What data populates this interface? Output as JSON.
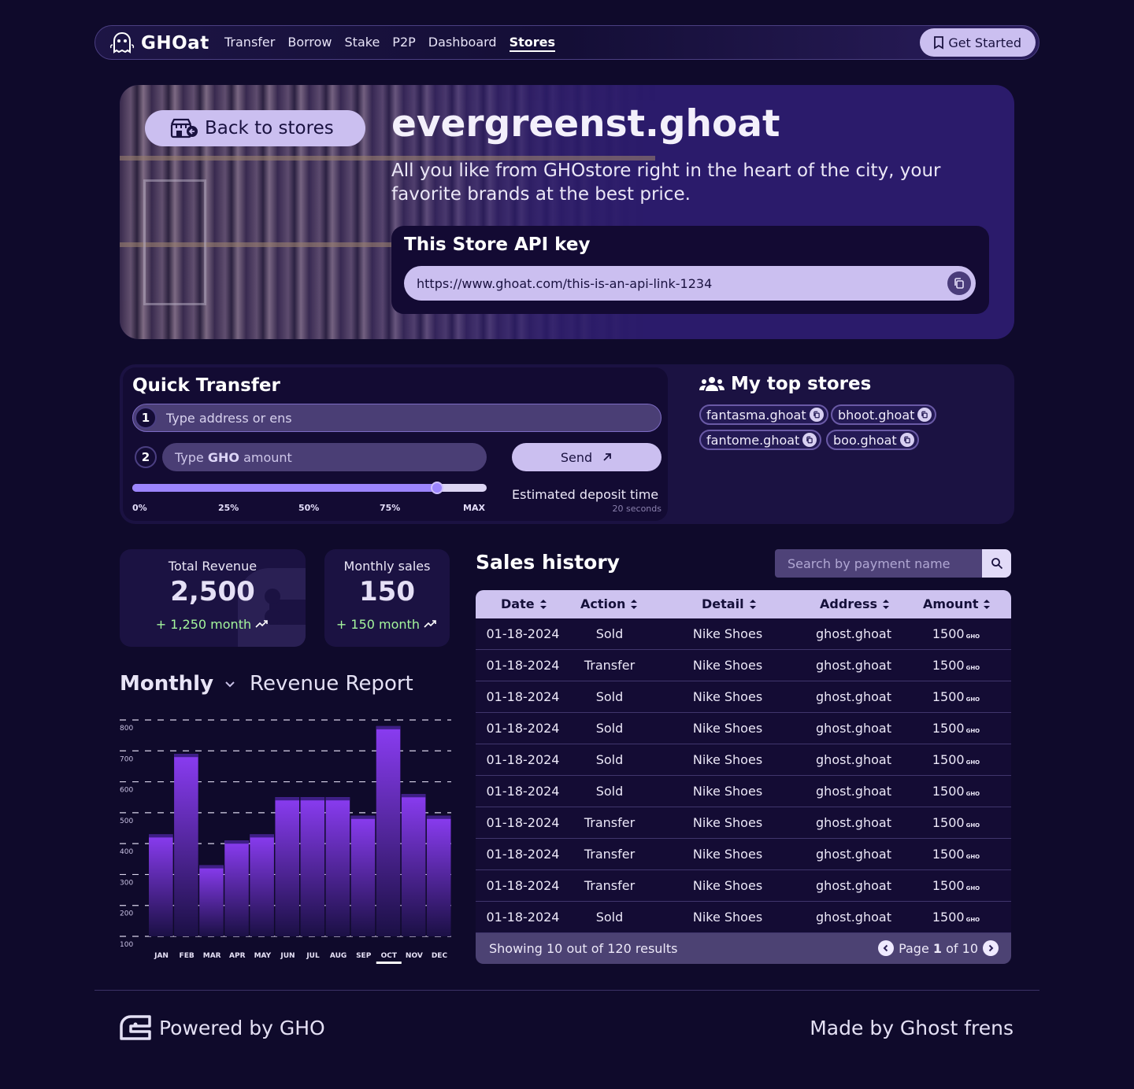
{
  "nav": {
    "brand": "GHOat",
    "links": [
      "Transfer",
      "Borrow",
      "Stake",
      "P2P",
      "Dashboard",
      "Stores"
    ],
    "active": "Stores",
    "cta": "Get Started"
  },
  "hero": {
    "back_label": "Back to stores",
    "store_name": "evergreenst.ghoat",
    "description": "All you like from GHOstore right in the heart of the city, your favorite brands at the best price.",
    "api_title": "This Store API key",
    "api_url": "https://www.ghoat.com/this-is-an-api-link-1234"
  },
  "quick_transfer": {
    "title": "Quick Transfer",
    "step1": "1",
    "step2": "2",
    "address_placeholder": "Type address or ens",
    "amount_prefix": "Type",
    "amount_token": "GHO",
    "amount_suffix": "amount",
    "send_label": "Send",
    "slider_labels": [
      "0%",
      "25%",
      "50%",
      "75%",
      "MAX"
    ],
    "slider_value_percent": 86,
    "deposit_label": "Estimated deposit time",
    "deposit_value": "20 seconds"
  },
  "top_stores": {
    "title": "My top stores",
    "stores": [
      "fantasma.ghoat",
      "bhoot.ghoat",
      "fantome.ghoat",
      "boo.ghoat"
    ]
  },
  "stats": [
    {
      "label": "Total Revenue",
      "value": "2,500",
      "change": "+ 1,250 month"
    },
    {
      "label": "Monthly sales",
      "value": "150",
      "change": "+ 150 month"
    }
  ],
  "report": {
    "period": "Monthly",
    "title": "Revenue Report"
  },
  "chart_data": {
    "type": "bar",
    "categories": [
      "JAN",
      "FEB",
      "MAR",
      "APR",
      "MAY",
      "JUN",
      "JUL",
      "AUG",
      "SEP",
      "OCT",
      "NOV",
      "DEC"
    ],
    "values": [
      430,
      690,
      330,
      410,
      430,
      550,
      550,
      550,
      490,
      780,
      560,
      490
    ],
    "yticks": [
      100,
      200,
      300,
      400,
      500,
      600,
      700,
      800
    ],
    "ylim": [
      100,
      800
    ],
    "highlighted": "OCT",
    "grid": true,
    "colors": {
      "bar_top": "#8a3cf2",
      "bar_bottom": "#1b1045",
      "grid": "#d9d4ea"
    }
  },
  "sales": {
    "title": "Sales history",
    "search_placeholder": "Search by payment name",
    "columns": [
      "Date",
      "Action",
      "Detail",
      "Address",
      "Amount"
    ],
    "currency": "GHO",
    "rows": [
      [
        "01-18-2024",
        "Sold",
        "Nike Shoes",
        "ghost.ghoat",
        "1500"
      ],
      [
        "01-18-2024",
        "Transfer",
        "Nike Shoes",
        "ghost.ghoat",
        "1500"
      ],
      [
        "01-18-2024",
        "Sold",
        "Nike Shoes",
        "ghost.ghoat",
        "1500"
      ],
      [
        "01-18-2024",
        "Sold",
        "Nike Shoes",
        "ghost.ghoat",
        "1500"
      ],
      [
        "01-18-2024",
        "Sold",
        "Nike Shoes",
        "ghost.ghoat",
        "1500"
      ],
      [
        "01-18-2024",
        "Sold",
        "Nike Shoes",
        "ghost.ghoat",
        "1500"
      ],
      [
        "01-18-2024",
        "Transfer",
        "Nike Shoes",
        "ghost.ghoat",
        "1500"
      ],
      [
        "01-18-2024",
        "Transfer",
        "Nike Shoes",
        "ghost.ghoat",
        "1500"
      ],
      [
        "01-18-2024",
        "Transfer",
        "Nike Shoes",
        "ghost.ghoat",
        "1500"
      ],
      [
        "01-18-2024",
        "Sold",
        "Nike Shoes",
        "ghost.ghoat",
        "1500"
      ]
    ],
    "showing": "Showing 10 out of 120 results",
    "page_word": "Page",
    "page_current": "1",
    "page_of": "of",
    "page_total": "10"
  },
  "footer": {
    "left": "Powered by GHO",
    "right": "Made by Ghost frens"
  },
  "icons": {
    "logo": "ghost-logo-icon",
    "cta": "bookmark-icon",
    "back": "store-icon",
    "copy": "copy-icon",
    "send": "arrow-up-right-icon",
    "stores": "users-icon",
    "trend": "trending-up-icon",
    "sort": "sort-icon",
    "search": "search-icon",
    "prev": "chevron-left-icon",
    "next": "chevron-right-icon"
  }
}
